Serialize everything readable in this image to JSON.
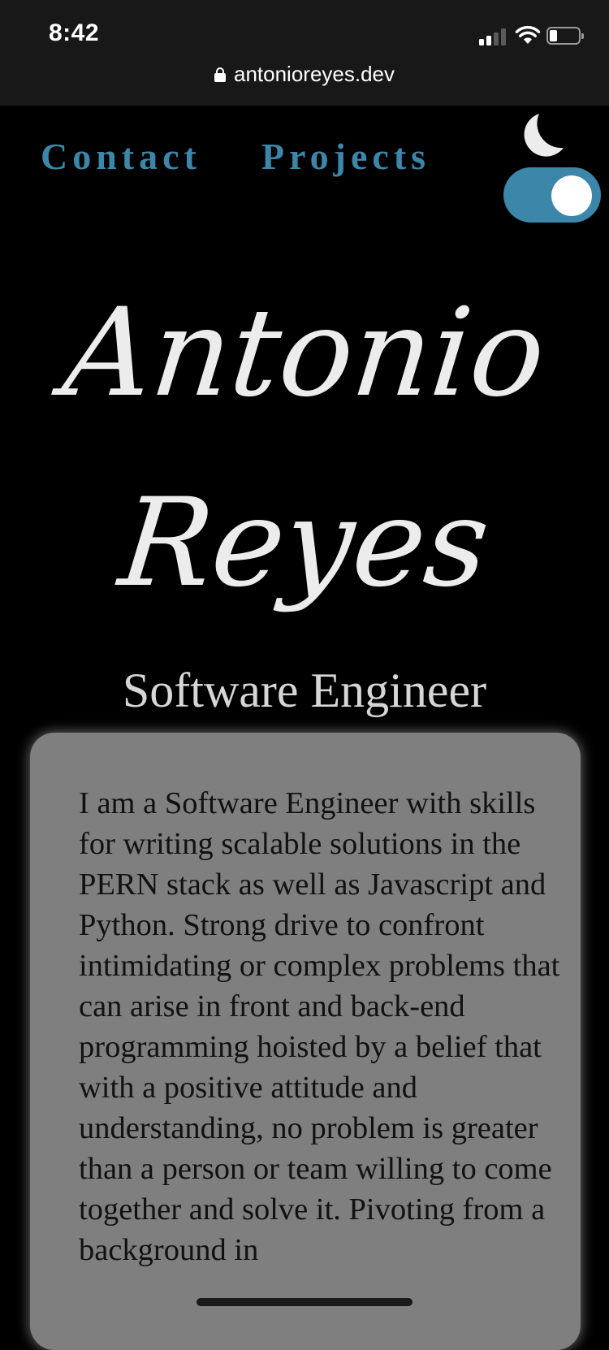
{
  "status_bar": {
    "time": "8:42",
    "signal_bars_active": 2,
    "signal_bars_total": 4,
    "battery_level": 0.25,
    "url": "antonioreyes.dev"
  },
  "nav": {
    "links": [
      {
        "label": "Contact"
      },
      {
        "label": "Projects"
      }
    ],
    "theme_toggle": {
      "mode": "dark",
      "on": true,
      "icon": "moon-icon"
    }
  },
  "hero": {
    "first_name": "Antonio",
    "last_name": "Reyes",
    "title": "Software Engineer"
  },
  "about": {
    "text": "I am a Software Engineer with skills for writing scalable solutions in the PERN stack as well as Javascript and Python. Strong drive to confront intimidating or complex problems that can arise in front and back-end programming hoisted by a belief that with a positive attitude and understanding, no problem is greater than a person or team willing to come together and solve it. Pivoting from a background in"
  },
  "colors": {
    "background": "#000000",
    "accent": "#3c86aa",
    "card": "#7f7f7f",
    "hero_text": "#ececec",
    "status_bar": "#181818"
  }
}
